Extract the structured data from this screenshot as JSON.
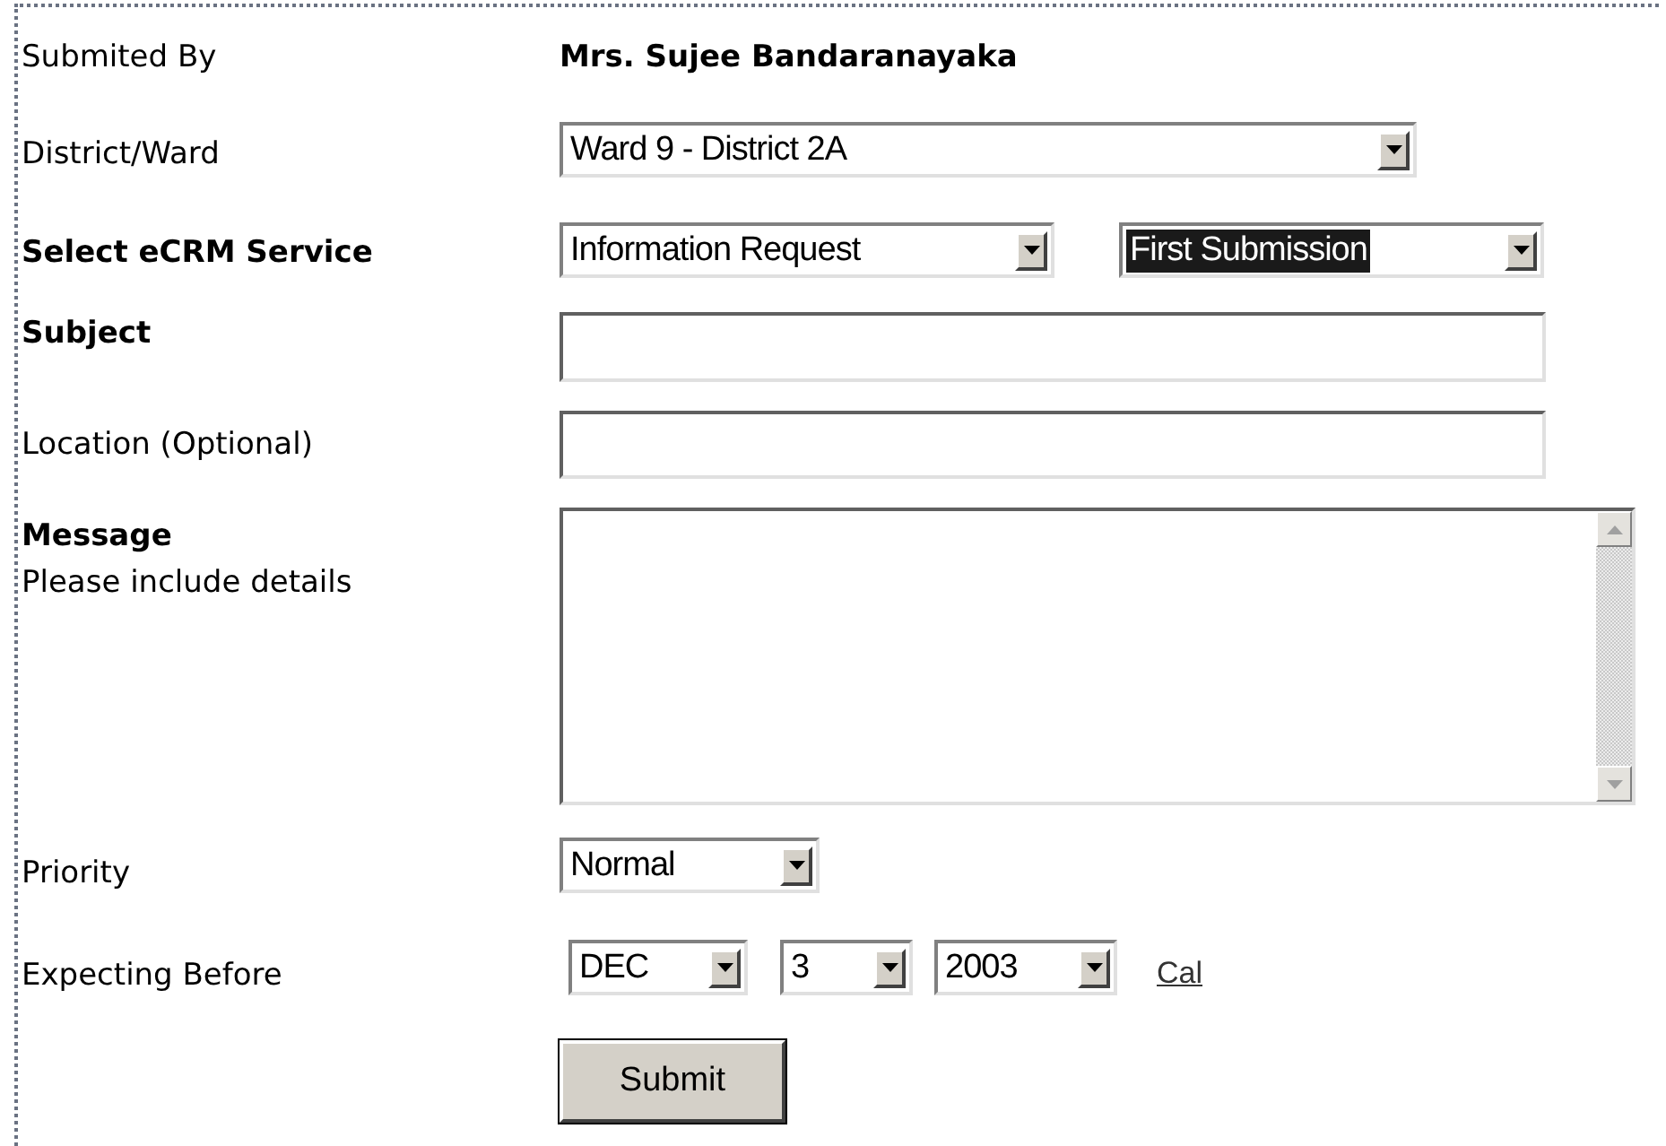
{
  "form": {
    "submitted_by": {
      "label": "Submited By",
      "value": "Mrs. Sujee Bandaranayaka"
    },
    "district": {
      "label": "District/Ward",
      "value": "Ward 9 - District 2A"
    },
    "service": {
      "label": "Select eCRM Service",
      "selects": [
        {
          "value": "Information Request",
          "highlighted": false
        },
        {
          "value": "First Submission",
          "highlighted": true
        }
      ]
    },
    "subject": {
      "label": "Subject"
    },
    "location": {
      "label": "Location (Optional)"
    },
    "message": {
      "label": "Message",
      "hint": "Please include details"
    },
    "priority": {
      "label": "Priority",
      "value": "Normal"
    },
    "expecting_before": {
      "label": "Expecting Before",
      "selects": [
        {
          "value": "DEC"
        },
        {
          "value": "3"
        },
        {
          "value": "2003"
        }
      ],
      "link": "Cal"
    },
    "submit": "Submit"
  }
}
